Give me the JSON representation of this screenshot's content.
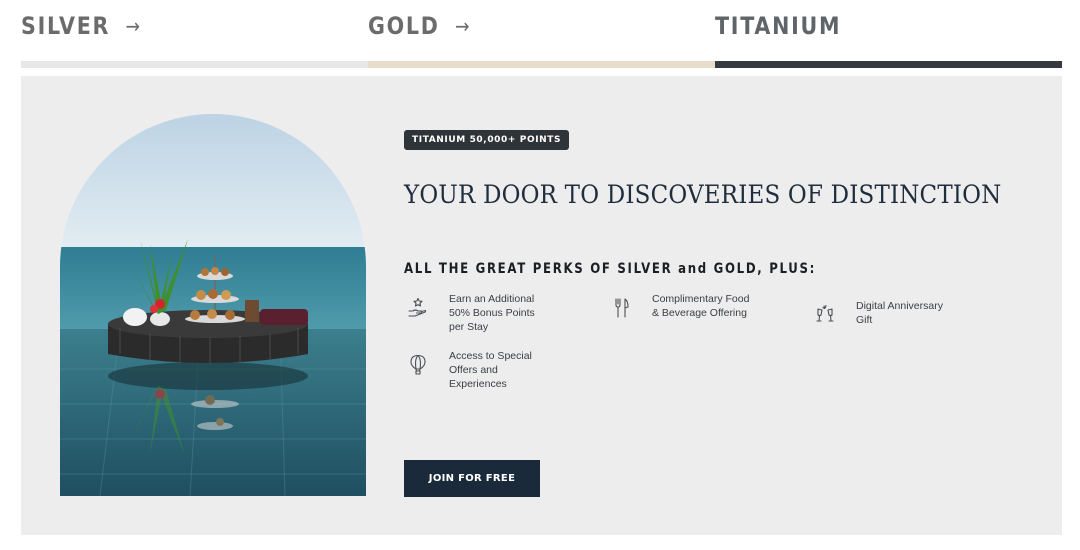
{
  "tiers": [
    {
      "name": "SILVER",
      "arrow": "→"
    },
    {
      "name": "GOLD",
      "arrow": "→"
    },
    {
      "name": "TITANIUM"
    }
  ],
  "badge": "TITANIUM 50,000+ POINTS",
  "headline": "YOUR DOOR TO DISCOVERIES OF DISTINCTION",
  "subhead": "ALL THE GREAT PERKS OF SILVER and GOLD, PLUS:",
  "perks": [
    {
      "icon": "hand-star-icon",
      "text": "Earn an Additional 50% Bonus Points per Stay"
    },
    {
      "icon": "fork-knife-icon",
      "text": "Complimentary Food & Beverage Offering"
    },
    {
      "icon": "champagne-glasses-icon",
      "text": "Digital Anniversary Gift"
    },
    {
      "icon": "hot-air-balloon-icon",
      "text": "Access to Special Offers and Experiences"
    }
  ],
  "join_button": "JOIN FOR FREE",
  "colors": {
    "panel": "#ededed",
    "silver_bar": "#e7e7e7",
    "gold_bar": "#e8dccc",
    "titanium_bar": "#343a40",
    "button": "#1b2a3b"
  }
}
